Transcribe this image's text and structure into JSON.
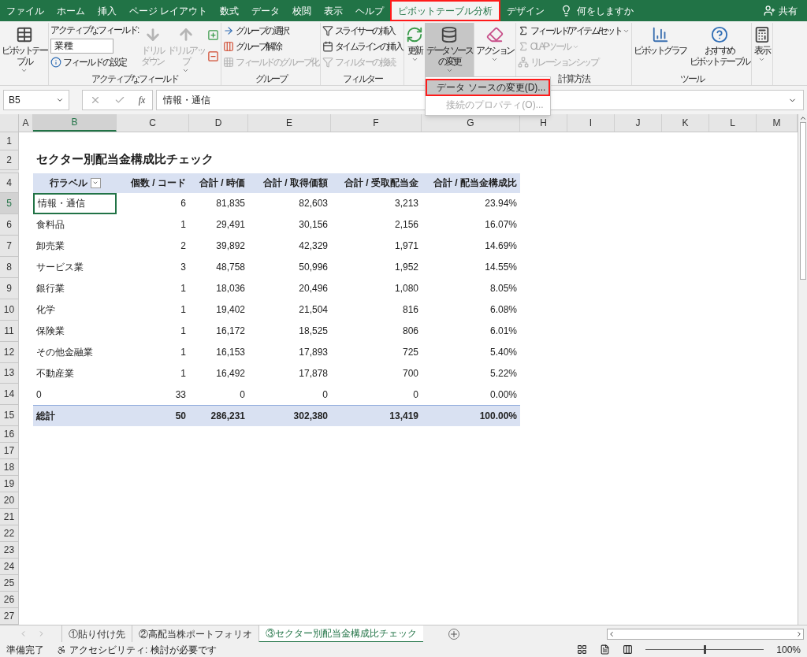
{
  "ribbon_tabs": [
    {
      "label": "ファイル",
      "selected": false,
      "highlighted": false
    },
    {
      "label": "ホーム",
      "selected": false,
      "highlighted": false
    },
    {
      "label": "挿入",
      "selected": false,
      "highlighted": false
    },
    {
      "label": "ページ レイアウト",
      "selected": false,
      "highlighted": false
    },
    {
      "label": "数式",
      "selected": false,
      "highlighted": false
    },
    {
      "label": "データ",
      "selected": false,
      "highlighted": false
    },
    {
      "label": "校閲",
      "selected": false,
      "highlighted": false
    },
    {
      "label": "表示",
      "selected": false,
      "highlighted": false
    },
    {
      "label": "ヘルプ",
      "selected": false,
      "highlighted": false
    },
    {
      "label": "ピボットテーブル分析",
      "selected": true,
      "highlighted": true
    },
    {
      "label": "デザイン",
      "selected": false,
      "highlighted": false
    }
  ],
  "tell_me": "何をしますか",
  "share": "共有",
  "ribbon_groups": [
    {
      "items": [
        {
          "kind": "large",
          "lines": [
            "ピボットテー",
            "ブル"
          ],
          "dropdown": true,
          "disabled": false,
          "pressed": false
        }
      ]
    },
    {
      "label": "アクティブなフィールド",
      "items": [
        {
          "kind": "field",
          "label": "アクティブなフィールド:",
          "value": "業種",
          "settings": "フィールドの設定"
        },
        {
          "kind": "large",
          "lines": [
            "ドリル",
            "ダウン"
          ],
          "dropdown": false,
          "disabled": true,
          "pressed": false
        },
        {
          "kind": "large",
          "lines": [
            "ドリルアッ",
            "プ"
          ],
          "dropdown": true,
          "disabled": true,
          "pressed": false
        },
        {
          "kind": "pm"
        }
      ]
    },
    {
      "label": "グループ",
      "items": [
        {
          "kind": "small",
          "label": "グループの選択",
          "dropdown": false,
          "disabled": false
        },
        {
          "kind": "small",
          "label": "グループ解除",
          "dropdown": false,
          "disabled": false
        },
        {
          "kind": "small",
          "label": "フィールドのグループ化",
          "dropdown": false,
          "disabled": true
        }
      ]
    },
    {
      "label": "フィルター",
      "items": [
        {
          "kind": "small",
          "label": "スライサーの挿入",
          "dropdown": false,
          "disabled": false
        },
        {
          "kind": "small",
          "label": "タイムラインの挿入",
          "dropdown": false,
          "disabled": false
        },
        {
          "kind": "small",
          "label": "フィルターの接続",
          "dropdown": false,
          "disabled": true
        }
      ]
    },
    {
      "items": [
        {
          "kind": "large",
          "lines": [
            "更新"
          ],
          "dropdown": true,
          "disabled": false,
          "pressed": false
        },
        {
          "kind": "large",
          "lines": [
            "データ ソース",
            "の変更"
          ],
          "dropdown": true,
          "disabled": false,
          "pressed": true
        }
      ]
    },
    {
      "items": [
        {
          "kind": "large",
          "lines": [
            "アクション"
          ],
          "dropdown": true,
          "disabled": false,
          "pressed": false
        }
      ]
    },
    {
      "label": "計算方法",
      "items": [
        {
          "kind": "small",
          "label": "フィールド/アイテム/セット",
          "dropdown": true,
          "disabled": false
        },
        {
          "kind": "small",
          "label": "OLAP ツール",
          "dropdown": true,
          "disabled": true
        },
        {
          "kind": "small",
          "label": "リレーションシップ",
          "dropdown": false,
          "disabled": true
        }
      ]
    },
    {
      "label": "ツール",
      "items": [
        {
          "kind": "large",
          "lines": [
            "ピボットグラフ"
          ],
          "dropdown": false,
          "disabled": false,
          "pressed": false
        },
        {
          "kind": "large",
          "lines": [
            "おすすめ",
            "ピボットテーブル"
          ],
          "dropdown": false,
          "disabled": false,
          "pressed": false
        }
      ]
    },
    {
      "items": [
        {
          "kind": "large",
          "lines": [
            "表示"
          ],
          "dropdown": true,
          "disabled": false,
          "pressed": false
        }
      ]
    }
  ],
  "menu": [
    {
      "label": "データ ソースの変更(D)...",
      "disabled": false,
      "highlighted": true
    },
    {
      "label": "接続のプロパティ(O)...",
      "disabled": true,
      "highlighted": false
    }
  ],
  "formula_bar": {
    "name_box": "B5",
    "fx": "fx",
    "formula": "情報・通信"
  },
  "columns": [
    {
      "label": "A",
      "selected": false
    },
    {
      "label": "B",
      "selected": true
    },
    {
      "label": "C",
      "selected": false
    },
    {
      "label": "D",
      "selected": false
    },
    {
      "label": "E",
      "selected": false
    },
    {
      "label": "F",
      "selected": false
    },
    {
      "label": "G",
      "selected": false
    },
    {
      "label": "H",
      "selected": false
    },
    {
      "label": "I",
      "selected": false
    },
    {
      "label": "J",
      "selected": false
    },
    {
      "label": "K",
      "selected": false
    },
    {
      "label": "L",
      "selected": false
    },
    {
      "label": "M",
      "selected": false
    }
  ],
  "rows": [
    {
      "label": "1",
      "selected": false
    },
    {
      "label": "2",
      "selected": false
    },
    {
      "label": "4",
      "selected": false
    },
    {
      "label": "5",
      "selected": true
    },
    {
      "label": "6",
      "selected": false
    },
    {
      "label": "7",
      "selected": false
    },
    {
      "label": "8",
      "selected": false
    },
    {
      "label": "9",
      "selected": false
    },
    {
      "label": "10",
      "selected": false
    },
    {
      "label": "11",
      "selected": false
    },
    {
      "label": "12",
      "selected": false
    },
    {
      "label": "13",
      "selected": false
    },
    {
      "label": "14",
      "selected": false
    },
    {
      "label": "15",
      "selected": false
    },
    {
      "label": "16",
      "selected": false
    },
    {
      "label": "17",
      "selected": false
    },
    {
      "label": "18",
      "selected": false
    },
    {
      "label": "19",
      "selected": false
    },
    {
      "label": "20",
      "selected": false
    },
    {
      "label": "21",
      "selected": false
    },
    {
      "label": "22",
      "selected": false
    },
    {
      "label": "23",
      "selected": false
    },
    {
      "label": "24",
      "selected": false
    },
    {
      "label": "25",
      "selected": false
    },
    {
      "label": "26",
      "selected": false
    },
    {
      "label": "27",
      "selected": false
    }
  ],
  "sheet_title": "セクター別配当金構成比チェック",
  "pivot": {
    "header": [
      "行ラベル",
      "個数 / コード",
      "合計 / 時価",
      "合計 / 取得価額",
      "合計 / 受取配当金",
      "合計 / 配当金構成比"
    ],
    "rows": [
      [
        "情報・通信",
        "6",
        "81,835",
        "82,603",
        "3,213",
        "23.94%"
      ],
      [
        "食料品",
        "1",
        "29,491",
        "30,156",
        "2,156",
        "16.07%"
      ],
      [
        "卸売業",
        "2",
        "39,892",
        "42,329",
        "1,971",
        "14.69%"
      ],
      [
        "サービス業",
        "3",
        "48,758",
        "50,996",
        "1,952",
        "14.55%"
      ],
      [
        "銀行業",
        "1",
        "18,036",
        "20,496",
        "1,080",
        "8.05%"
      ],
      [
        "化学",
        "1",
        "19,402",
        "21,504",
        "816",
        "6.08%"
      ],
      [
        "保険業",
        "1",
        "16,172",
        "18,525",
        "806",
        "6.01%"
      ],
      [
        "その他金融業",
        "1",
        "16,153",
        "17,893",
        "725",
        "5.40%"
      ],
      [
        "不動産業",
        "1",
        "16,492",
        "17,878",
        "700",
        "5.22%"
      ],
      [
        "0",
        "33",
        "0",
        "0",
        "0",
        "0.00%"
      ]
    ],
    "total": [
      "総計",
      "50",
      "286,231",
      "302,380",
      "13,419",
      "100.00%"
    ]
  },
  "sheet_tabs": [
    {
      "label": "①貼り付け先",
      "selected": false
    },
    {
      "label": "②高配当株ポートフォリオ",
      "selected": false
    },
    {
      "label": "③セクター別配当金構成比チェック",
      "selected": true
    }
  ],
  "status": {
    "ready": "準備完了",
    "accessibility": "アクセシビリティ: 検討が必要です",
    "zoom": "100%",
    "zoom_slider": {
      "level": 0.5
    }
  }
}
